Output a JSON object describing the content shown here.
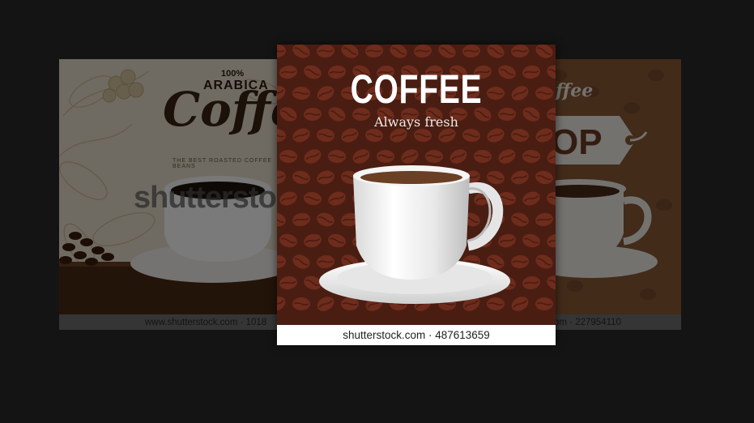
{
  "carousel": {
    "left_card": {
      "pct_text": "100%",
      "arabica_text": "ARABICA",
      "coffee_script": "Coffee",
      "tagline": "THE BEST ROASTED COFFEE BEANS",
      "watermark": "shutterstock",
      "caption": "www.shutterstock.com · 1018"
    },
    "center_card": {
      "title": "COFFEE",
      "subtitle": "Always fresh",
      "caption": "shutterstock.com · 487613659"
    },
    "right_card": {
      "script_text": "ffee",
      "sign_text": "OP",
      "caption": "om · 227954110"
    }
  },
  "colors": {
    "page_background": "#141414",
    "center_bg": "#4a1d12",
    "bean": "#6e2c1c",
    "caption_bar": "#ffffff"
  }
}
